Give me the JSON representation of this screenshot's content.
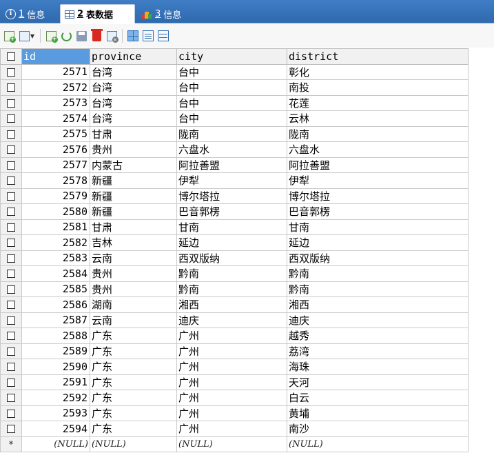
{
  "tabs": [
    {
      "num": "1",
      "label": "信息",
      "icon": "info-icon",
      "active": false
    },
    {
      "num": "2",
      "label": "表数据",
      "icon": "table-grid-icon",
      "active": true
    },
    {
      "num": "3",
      "label": "信息",
      "icon": "color-bars-icon",
      "active": false
    }
  ],
  "toolbar": {
    "buttons": [
      "add-row-icon",
      "insert-dropdown-icon",
      "duplicate-row-icon",
      "refresh-icon",
      "save-icon",
      "delete-icon",
      "cancel-changes-icon",
      "grid-view-icon",
      "form-view-icon",
      "text-view-icon"
    ]
  },
  "grid": {
    "columns": [
      "id",
      "province",
      "city",
      "district"
    ],
    "selected_column": "id",
    "rows": [
      {
        "id": "2571",
        "province": "台湾",
        "city": "台中",
        "district": "彰化"
      },
      {
        "id": "2572",
        "province": "台湾",
        "city": "台中",
        "district": "南投"
      },
      {
        "id": "2573",
        "province": "台湾",
        "city": "台中",
        "district": "花莲"
      },
      {
        "id": "2574",
        "province": "台湾",
        "city": "台中",
        "district": "云林"
      },
      {
        "id": "2575",
        "province": "甘肃",
        "city": "陇南",
        "district": "陇南"
      },
      {
        "id": "2576",
        "province": "贵州",
        "city": "六盘水",
        "district": "六盘水"
      },
      {
        "id": "2577",
        "province": "内蒙古",
        "city": "阿拉善盟",
        "district": "阿拉善盟"
      },
      {
        "id": "2578",
        "province": "新疆",
        "city": "伊犁",
        "district": "伊犁"
      },
      {
        "id": "2579",
        "province": "新疆",
        "city": "博尔塔拉",
        "district": "博尔塔拉"
      },
      {
        "id": "2580",
        "province": "新疆",
        "city": "巴音郭楞",
        "district": "巴音郭楞"
      },
      {
        "id": "2581",
        "province": "甘肃",
        "city": "甘南",
        "district": "甘南"
      },
      {
        "id": "2582",
        "province": "吉林",
        "city": "延边",
        "district": "延边"
      },
      {
        "id": "2583",
        "province": "云南",
        "city": "西双版纳",
        "district": "西双版纳"
      },
      {
        "id": "2584",
        "province": "贵州",
        "city": "黔南",
        "district": "黔南"
      },
      {
        "id": "2585",
        "province": "贵州",
        "city": "黔南",
        "district": "黔南"
      },
      {
        "id": "2586",
        "province": "湖南",
        "city": "湘西",
        "district": "湘西"
      },
      {
        "id": "2587",
        "province": "云南",
        "city": "迪庆",
        "district": "迪庆"
      },
      {
        "id": "2588",
        "province": "广东",
        "city": "广州",
        "district": "越秀"
      },
      {
        "id": "2589",
        "province": "广东",
        "city": "广州",
        "district": "荔湾"
      },
      {
        "id": "2590",
        "province": "广东",
        "city": "广州",
        "district": "海珠"
      },
      {
        "id": "2591",
        "province": "广东",
        "city": "广州",
        "district": "天河"
      },
      {
        "id": "2592",
        "province": "广东",
        "city": "广州",
        "district": "白云"
      },
      {
        "id": "2593",
        "province": "广东",
        "city": "广州",
        "district": "黄埔"
      },
      {
        "id": "2594",
        "province": "广东",
        "city": "广州",
        "district": "南沙"
      }
    ],
    "new_row": {
      "marker": "*",
      "id": "(NULL)",
      "province": "(NULL)",
      "city": "(NULL)",
      "district": "(NULL)"
    }
  }
}
